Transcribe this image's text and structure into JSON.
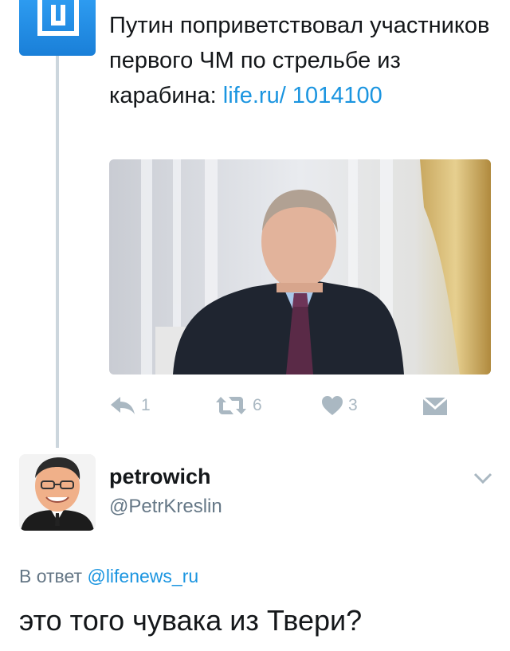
{
  "tweet": {
    "text": "Путин поприветствовал участников первого ЧМ по стрельбе из карабина: ",
    "link": "life.ru/ 1014100",
    "photo_icon": "photo-person-in-suit",
    "actions": {
      "reply_count": "1",
      "retweet_count": "6",
      "like_count": "3"
    }
  },
  "reply": {
    "user_name": "petrowich",
    "user_handle": "@PetrKreslin",
    "reply_to_prefix": "В ответ ",
    "reply_to_handle": "@lifenews_ru",
    "text": "это того чувака из Твери?"
  },
  "colors": {
    "link": "#1b95e0",
    "muted": "#aab8c2",
    "text": "#14171a",
    "handle": "#657786",
    "logo_bg": "#1a7fd8"
  }
}
